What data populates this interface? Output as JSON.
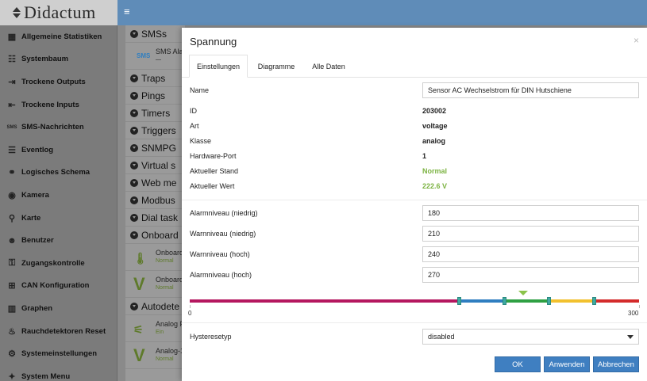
{
  "app": {
    "logo": "Didactum"
  },
  "sidebar": {
    "items": [
      {
        "label": "Allgemeine Statistiken",
        "icon": "grid-icon",
        "glyph": "▦"
      },
      {
        "label": "Systembaum",
        "icon": "tree-icon",
        "glyph": "☷"
      },
      {
        "label": "Trockene Outputs",
        "icon": "output-icon",
        "glyph": "⇥"
      },
      {
        "label": "Trockene Inputs",
        "icon": "input-icon",
        "glyph": "⇤"
      },
      {
        "label": "SMS-Nachrichten",
        "icon": "sms-icon",
        "glyph": "SMS"
      },
      {
        "label": "Eventlog",
        "icon": "list-icon",
        "glyph": "☰"
      },
      {
        "label": "Logisches Schema",
        "icon": "link-icon",
        "glyph": "⚭"
      },
      {
        "label": "Kamera",
        "icon": "eye-icon",
        "glyph": "◉"
      },
      {
        "label": "Karte",
        "icon": "map-pin-icon",
        "glyph": "⚲"
      },
      {
        "label": "Benutzer",
        "icon": "user-icon",
        "glyph": "☻"
      },
      {
        "label": "Zugangskontrolle",
        "icon": "lock-icon",
        "glyph": "⚿"
      },
      {
        "label": "CAN Konfiguration",
        "icon": "can-icon",
        "glyph": "⊞"
      },
      {
        "label": "Graphen",
        "icon": "chart-icon",
        "glyph": "▥"
      },
      {
        "label": "Rauchdetektoren Reset",
        "icon": "fire-icon",
        "glyph": "♨"
      },
      {
        "label": "Systemeinstellungen",
        "icon": "sliders-icon",
        "glyph": "⚙"
      },
      {
        "label": "System Menu",
        "icon": "bulb-icon",
        "glyph": "✦"
      }
    ]
  },
  "background_list": {
    "rows_top": [
      {
        "label": "SMSs"
      }
    ],
    "sms_row": {
      "badge": "SMS",
      "title": "SMS Alar",
      "sub": "—"
    },
    "rows": [
      {
        "label": "Traps"
      },
      {
        "label": "Pings"
      },
      {
        "label": "Timers"
      },
      {
        "label": "Triggers"
      },
      {
        "label": "SNMPG"
      },
      {
        "label": "Virtual s"
      },
      {
        "label": "Web me"
      },
      {
        "label": "Modbus"
      },
      {
        "label": "Dial task"
      },
      {
        "label": "Onboard"
      }
    ],
    "onboard_items": [
      {
        "title": "Onboard",
        "status": "Normal",
        "icon": "thermometer-icon"
      },
      {
        "title": "Onboard",
        "status": "Normal",
        "icon": "voltage-v-icon",
        "glyph": "V"
      }
    ],
    "autodetect_row": {
      "label": "Autodete"
    },
    "analog_items": [
      {
        "title": "Analog P",
        "status": "Ein",
        "icon": "plug-icon"
      },
      {
        "title": "Analog-1",
        "status": "Normal",
        "icon": "voltage-v-icon",
        "glyph": "V"
      }
    ]
  },
  "modal": {
    "title": "Spannung",
    "close": "×",
    "tabs": [
      {
        "label": "Einstellungen",
        "active": true
      },
      {
        "label": "Diagramme",
        "active": false
      },
      {
        "label": "Alle Daten",
        "active": false
      }
    ],
    "name_label": "Name",
    "name_value": "Sensor AC Wechselstrom für DIN Hutschiene",
    "info": [
      {
        "label": "ID",
        "value": "203002"
      },
      {
        "label": "Art",
        "value": "voltage"
      },
      {
        "label": "Klasse",
        "value": "analog"
      },
      {
        "label": "Hardware-Port",
        "value": "1"
      },
      {
        "label": "Aktueller Stand",
        "value": "Normal"
      },
      {
        "label": "Aktueller Wert",
        "value": "222.6 V"
      }
    ],
    "thresholds": [
      {
        "label": "Alarmniveau (niedrig)",
        "value": "180"
      },
      {
        "label": "Warnniveau (niedrig)",
        "value": "210"
      },
      {
        "label": "Warnniveau (hoch)",
        "value": "240"
      },
      {
        "label": "Alarmniveau (hoch)",
        "value": "270"
      }
    ],
    "range": {
      "min": 0,
      "max": 300,
      "min_label": "0",
      "max_label": "300",
      "current": 222.6,
      "colors": {
        "alarm": "#b5175f",
        "warn_low": "#2f7ec0",
        "normal": "#2fa043",
        "warn_high": "#f2c12e",
        "alarm_high": "#d42b2b"
      }
    },
    "hysteresis_label": "Hysteresetyp",
    "hysteresis_value": "disabled",
    "buttons": {
      "ok": "OK",
      "apply": "Anwenden",
      "cancel": "Abbrechen"
    }
  }
}
